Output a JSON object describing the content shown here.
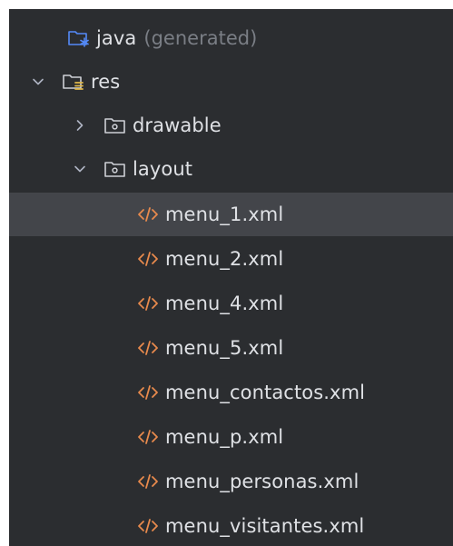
{
  "tree": {
    "java_item": {
      "label": "java",
      "hint": "(generated)"
    },
    "res_item": {
      "label": "res"
    },
    "drawable_item": {
      "label": "drawable"
    },
    "layout_item": {
      "label": "layout"
    },
    "files": [
      {
        "label": "menu_1.xml",
        "selected": true
      },
      {
        "label": "menu_2.xml",
        "selected": false
      },
      {
        "label": "menu_4.xml",
        "selected": false
      },
      {
        "label": "menu_5.xml",
        "selected": false
      },
      {
        "label": "menu_contactos.xml",
        "selected": false
      },
      {
        "label": "menu_p.xml",
        "selected": false
      },
      {
        "label": "menu_personas.xml",
        "selected": false
      },
      {
        "label": "menu_visitantes.xml",
        "selected": false
      }
    ]
  },
  "colors": {
    "panel_bg": "#2b2d30",
    "selected_bg": "#43454a",
    "text": "#dfe1e5",
    "hint": "#7a7e85",
    "folder_blue": "#548af7",
    "xml_orange": "#e88a4d"
  },
  "icons": {
    "java_folder": "generated-source-folder-icon",
    "res_folder": "resource-folder-icon",
    "package_folder": "package-folder-icon",
    "xml_file": "xml-file-icon",
    "expand": "chevron-down-icon",
    "collapse": "chevron-right-icon"
  }
}
